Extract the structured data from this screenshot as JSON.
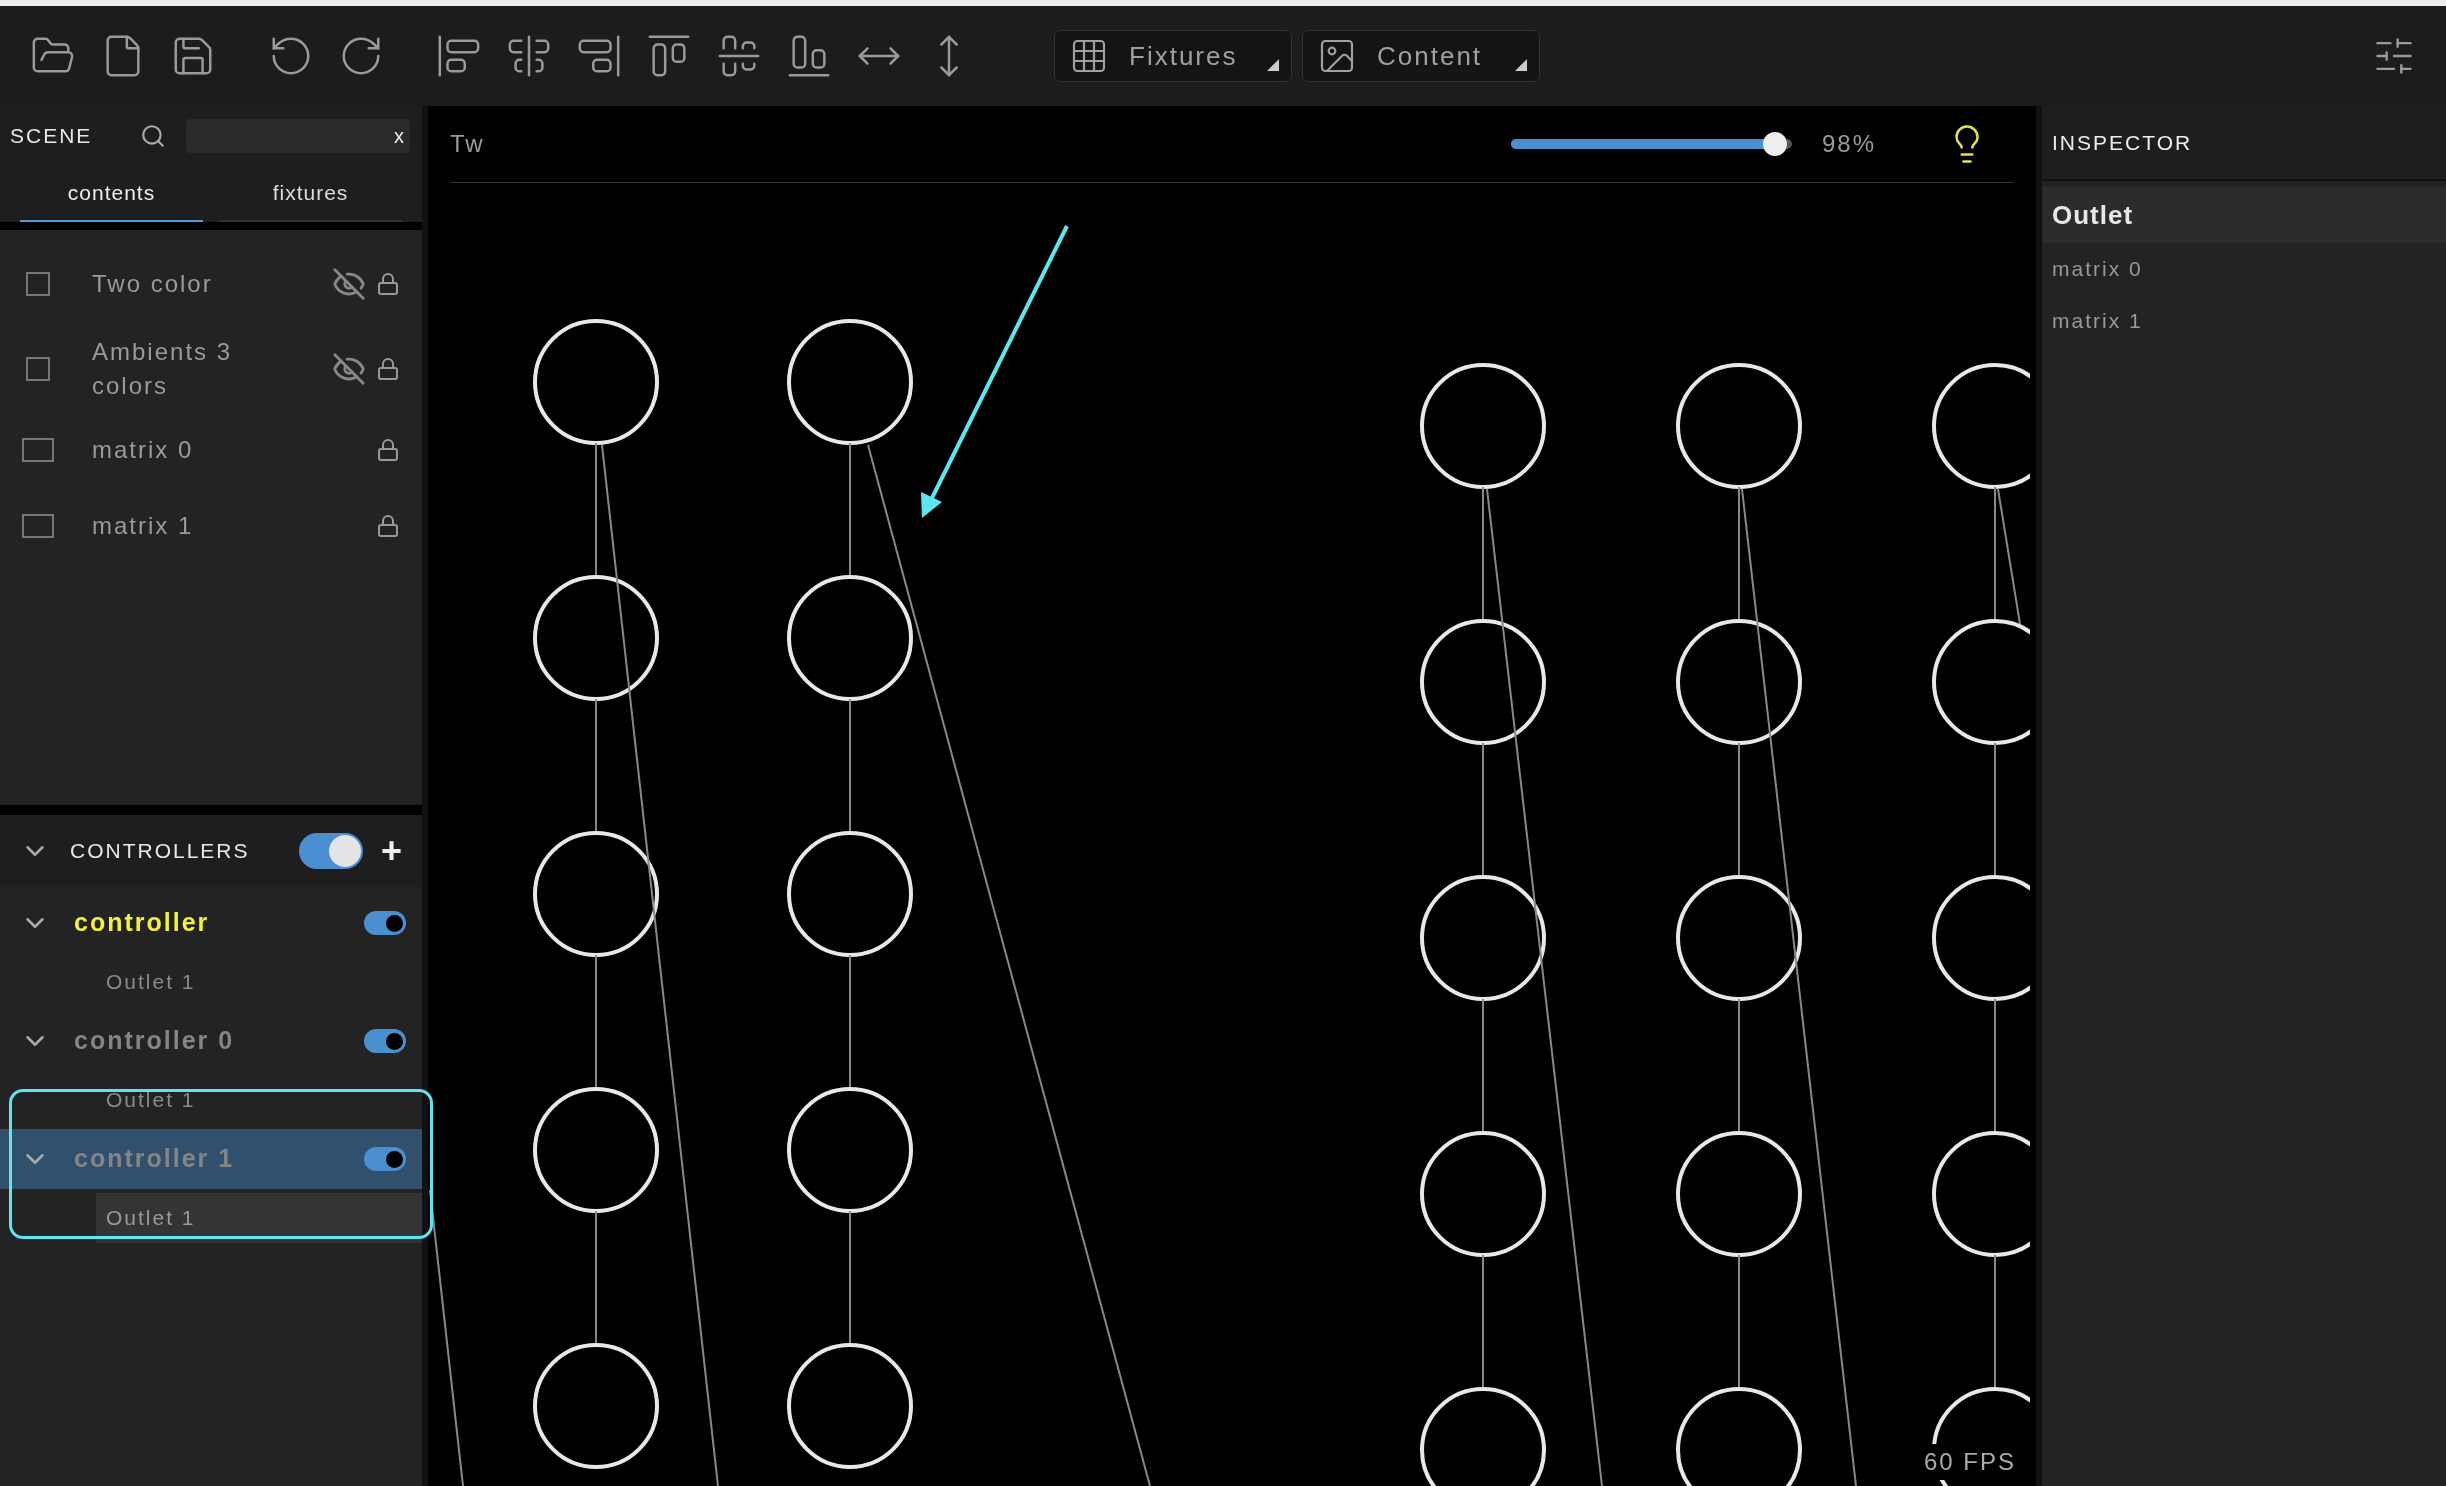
{
  "toolbar": {
    "dropdowns": [
      {
        "label": "Fixtures",
        "kind": "fixtures"
      },
      {
        "label": "Content",
        "kind": "content"
      }
    ]
  },
  "scene": {
    "title": "SCENE",
    "search": {
      "clear": "x"
    },
    "tabs": [
      {
        "label": "contents",
        "selected": true
      },
      {
        "label": "fixtures",
        "selected": false
      }
    ],
    "items": [
      {
        "name": "Two color",
        "kind": "fixture",
        "checked": false,
        "hidden": true,
        "locked": true
      },
      {
        "name": "Ambients 3 colors",
        "kind": "fixture",
        "checked": false,
        "hidden": true,
        "locked": true
      },
      {
        "name": "matrix 0",
        "kind": "matrix",
        "checked": false,
        "hidden": false,
        "locked": true
      },
      {
        "name": "matrix 1",
        "kind": "matrix",
        "checked": false,
        "hidden": false,
        "locked": true
      }
    ]
  },
  "controllers": {
    "title": "CONTROLLERS",
    "on": true,
    "add": "+",
    "items": [
      {
        "name": "controller",
        "active": true,
        "selected": false,
        "on": true,
        "expanded": true,
        "children": [
          {
            "name": "Outlet 1",
            "selected": false
          }
        ]
      },
      {
        "name": "controller 0",
        "active": false,
        "selected": false,
        "on": true,
        "expanded": true,
        "children": [
          {
            "name": "Outlet 1",
            "selected": false
          }
        ]
      },
      {
        "name": "controller 1",
        "active": false,
        "selected": true,
        "on": true,
        "expanded": true,
        "children": [
          {
            "name": "Outlet 1",
            "selected": true
          }
        ]
      }
    ]
  },
  "canvas": {
    "title": "Tw",
    "brightness": {
      "level": 0.98,
      "reading": "98%"
    },
    "fps": "60 FPS"
  },
  "inspector": {
    "title": "INSPECTOR",
    "heading": "Outlet",
    "items": [
      "matrix 0",
      "matrix 1"
    ]
  }
}
